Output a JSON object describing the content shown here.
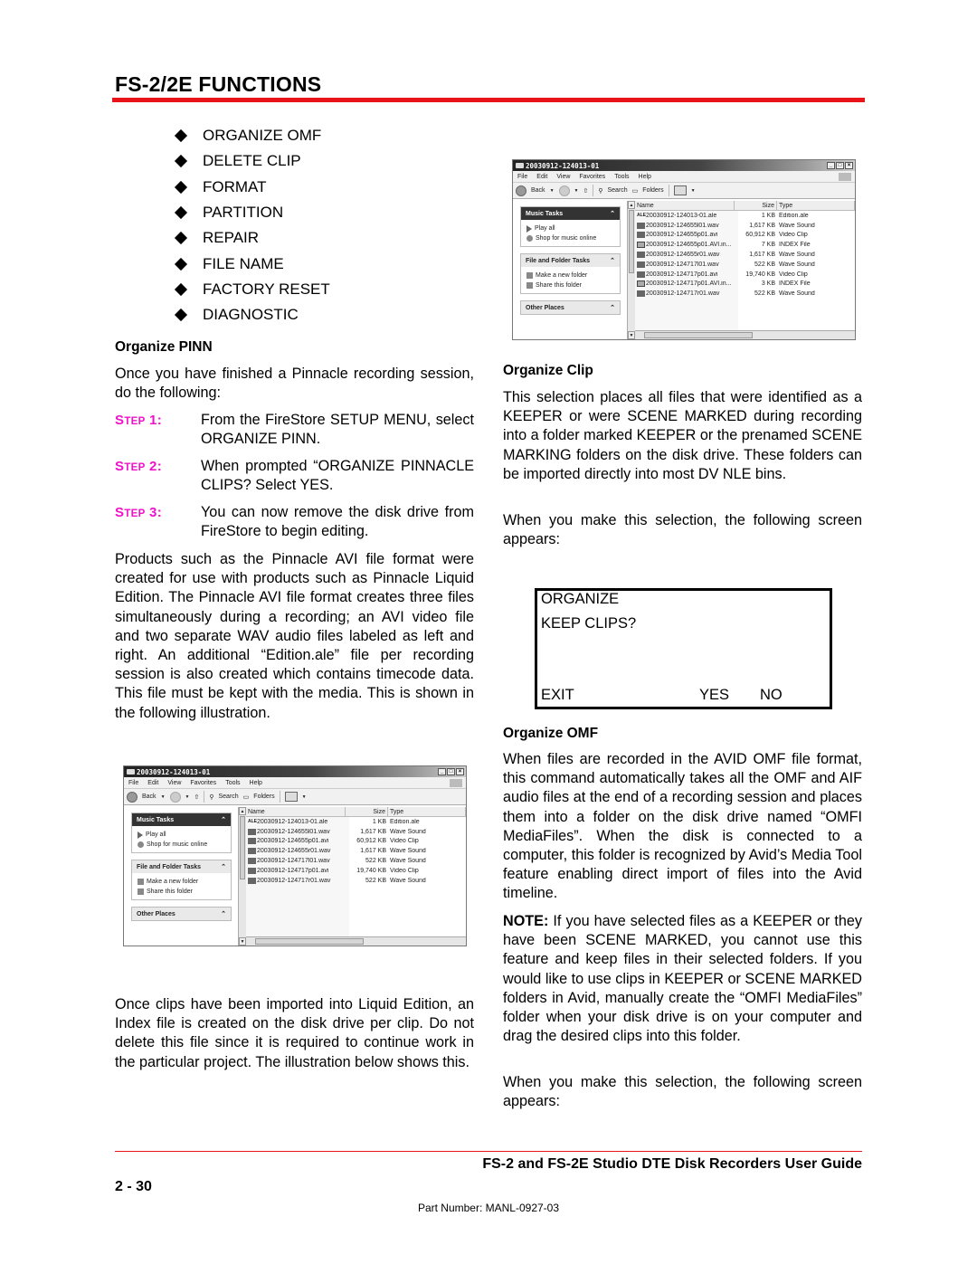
{
  "header": {
    "title": "FS-2/2E FUNCTIONS",
    "accent_color": "#e8141a"
  },
  "bullets": [
    "ORGANIZE OMF",
    "DELETE CLIP",
    "FORMAT",
    "PARTITION",
    "REPAIR",
    "FILE NAME",
    "FACTORY RESET",
    "DIAGNOSTIC"
  ],
  "left": {
    "organize_pinn": {
      "heading": "Organize PINN",
      "intro": "Once you have finished a Pinnacle recording session, do the following:",
      "step_prefix": "S",
      "step_word": "TEP",
      "step_color": "#f012c8",
      "steps": [
        {
          "number": "1:",
          "text": "From the FireStore SETUP MENU, select ORGANIZE PINN."
        },
        {
          "number": "2:",
          "text": "When prompted “ORGANIZE PINNACLE CLIPS? Select YES."
        },
        {
          "number": "3:",
          "text": "You can now remove the disk drive from FireStore to begin editing."
        }
      ],
      "body": "Products such as the Pinnacle AVI file format were created for use with products such as Pinnacle Liquid Edition. The Pinnacle AVI file format creates three files simultaneously during a recording; an AVI video file and two separate WAV audio files labeled as left and right. An additional “Edition.ale” file per recording session is also created which contains timecode data. This file must be kept with the media. This is shown in the following illustration."
    },
    "after_illustration": "Once clips have been imported into Liquid Edition, an Index file is created on the disk drive per clip. Do not delete this file since it is required to continue work in the particular project. The illustration below shows this."
  },
  "explorer_common": {
    "window_title": "20030912-124013-01",
    "menu": [
      "File",
      "Edit",
      "View",
      "Favorites",
      "Tools",
      "Help"
    ],
    "toolbar": {
      "back": "Back",
      "search": "Search",
      "folders": "Folders"
    },
    "panels": {
      "music_tasks": {
        "title": "Music Tasks",
        "items": [
          "Play all",
          "Shop for music online"
        ]
      },
      "file_folder_tasks": {
        "title": "File and Folder Tasks",
        "items": [
          "Make a new folder",
          "Share this folder"
        ]
      },
      "other_places": {
        "title": "Other Places"
      }
    },
    "columns": {
      "name": "Name",
      "size": "Size",
      "type": "Type"
    }
  },
  "explorer_left_files": [
    {
      "icon": "ale",
      "name": "20030912-124013-01.ale",
      "size": "1 KB",
      "type": "Edition.ale"
    },
    {
      "icon": "wav",
      "name": "20030912-124655l01.wav",
      "size": "1,617 KB",
      "type": "Wave Sound"
    },
    {
      "icon": "avi",
      "name": "20030912-124655p01.avi",
      "size": "60,912 KB",
      "type": "Video Clip"
    },
    {
      "icon": "wav",
      "name": "20030912-124655r01.wav",
      "size": "1,617 KB",
      "type": "Wave Sound"
    },
    {
      "icon": "wav",
      "name": "20030912-124717l01.wav",
      "size": "522 KB",
      "type": "Wave Sound"
    },
    {
      "icon": "avi",
      "name": "20030912-124717p01.avi",
      "size": "19,740 KB",
      "type": "Video Clip"
    },
    {
      "icon": "wav",
      "name": "20030912-124717r01.wav",
      "size": "522 KB",
      "type": "Wave Sound"
    }
  ],
  "explorer_right_files": [
    {
      "icon": "ale",
      "name": "20030912-124013-01.ale",
      "size": "1 KB",
      "type": "Edition.ale"
    },
    {
      "icon": "wav",
      "name": "20030912-124655l01.wav",
      "size": "1,617 KB",
      "type": "Wave Sound"
    },
    {
      "icon": "avi",
      "name": "20030912-124655p01.avi",
      "size": "60,912 KB",
      "type": "Video Clip"
    },
    {
      "icon": "idx",
      "name": "20030912-124655p01.AVI.in...",
      "size": "7 KB",
      "type": "INDEX File"
    },
    {
      "icon": "wav",
      "name": "20030912-124655r01.wav",
      "size": "1,617 KB",
      "type": "Wave Sound"
    },
    {
      "icon": "wav",
      "name": "20030912-124717l01.wav",
      "size": "522 KB",
      "type": "Wave Sound"
    },
    {
      "icon": "avi",
      "name": "20030912-124717p01.avi",
      "size": "19,740 KB",
      "type": "Video Clip"
    },
    {
      "icon": "idx",
      "name": "20030912-124717p01.AVI.in...",
      "size": "3 KB",
      "type": "INDEX File"
    },
    {
      "icon": "wav",
      "name": "20030912-124717r01.wav",
      "size": "522 KB",
      "type": "Wave Sound"
    }
  ],
  "right": {
    "organize_clip": {
      "heading": "Organize Clip",
      "body": "This selection places all files that were identified as a KEEPER or were SCENE MARKED during recording into a folder marked KEEPER or the prenamed SCENE MARKING folders on the disk drive. These folders can be imported directly into most DV NLE bins.",
      "followup": "When you make this selection, the following screen appears:"
    },
    "lcd": {
      "line1": "ORGANIZE",
      "line2": "KEEP CLIPS?",
      "exit": "EXIT",
      "yes": "YES",
      "no": "NO"
    },
    "organize_omf": {
      "heading": "Organize OMF",
      "body": "When files are recorded in the AVID OMF file format, this command automatically takes all the OMF and AIF audio files at the end of a recording session and places them into a folder on the disk drive named “OMFI MediaFiles”. When the disk is connected to a computer, this folder is recognized by Avid’s Media Tool feature enabling direct import of files into the Avid timeline.",
      "note_label": "NOTE:",
      "note_text": " If you have selected files as a KEEPER or they have been SCENE MARKED, you cannot use this feature and keep files in their selected folders. If you would like to use clips in KEEPER or SCENE MARKED folders in Avid, manually create the “OMFI MediaFiles” folder when your disk drive is on your computer and drag the desired clips into this folder.",
      "followup": "When you make this selection, the following screen appears:"
    }
  },
  "footer": {
    "guide_title": "FS-2 and FS-2E Studio DTE Disk Recorders User Guide",
    "page_number": "2 - 30",
    "part_number": "Part Number: MANL-0927-03"
  }
}
